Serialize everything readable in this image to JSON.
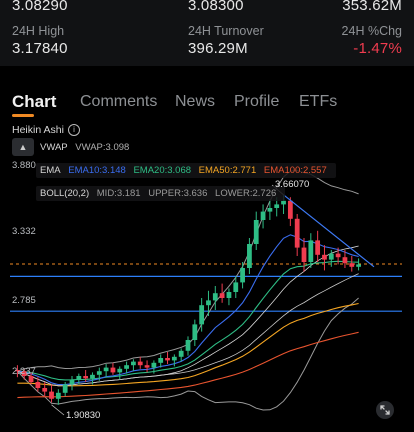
{
  "stats": {
    "row1": {
      "v1": "3.08290",
      "v2": "3.08300",
      "v3": "353.62M"
    },
    "labels": {
      "high": "24H High",
      "turnover": "24H Turnover",
      "chg": "24H %Chg"
    },
    "row2": {
      "high": "3.17840",
      "turnover": "396.29M",
      "chg": "-1.47%"
    }
  },
  "tabs": [
    "Chart",
    "Comments",
    "News",
    "Profile",
    "ETFs"
  ],
  "chart_header": {
    "type_label": "Heikin Ashi",
    "collapse": "▲"
  },
  "indicators": {
    "vwap": {
      "name": "VWAP",
      "text": "VWAP:3.098"
    },
    "ema": {
      "name": "EMA",
      "ema10": "EMA10:3.148",
      "ema20": "EMA20:3.068",
      "ema50": "EMA50:2.771",
      "ema100": "EMA100:2.557"
    },
    "boll": {
      "name": "BOLL(20,2)",
      "mid": "MID:3.181",
      "upper": "UPPER:3.636",
      "lower": "LOWER:2.726"
    }
  },
  "y_axis": [
    "3.880",
    "3.332",
    "2.785",
    "2.237"
  ],
  "price_labels": {
    "high": "3.66070",
    "low": "1.90830"
  },
  "colors": {
    "up": "#2ebd85",
    "down": "#f03c4f",
    "ema10": "#3a6df0",
    "ema20": "#2ebd85",
    "ema50": "#f5a623",
    "ema100": "#e8542f",
    "vwap": "#c9c9c9",
    "boll_upper": "#9a9a9a",
    "boll_lower": "#9a9a9a",
    "boll_mid": "#d8d8d8",
    "hline": "#2d7ff9",
    "trend": "#3d7af5",
    "last_price": "#f08a24"
  },
  "chart_data": {
    "type": "candlestick",
    "ylim": [
      1.85,
      3.95
    ],
    "candles": [
      [
        2.2,
        2.24,
        2.14,
        2.19
      ],
      [
        2.19,
        2.21,
        2.12,
        2.15
      ],
      [
        2.15,
        2.18,
        2.08,
        2.1
      ],
      [
        2.1,
        2.14,
        2.02,
        2.05
      ],
      [
        2.05,
        2.1,
        1.98,
        2.02
      ],
      [
        2.02,
        2.08,
        1.93,
        1.96
      ],
      [
        1.96,
        2.04,
        1.91,
        2.01
      ],
      [
        2.01,
        2.1,
        1.98,
        2.08
      ],
      [
        2.08,
        2.15,
        2.03,
        2.12
      ],
      [
        2.12,
        2.17,
        2.08,
        2.15
      ],
      [
        2.15,
        2.2,
        2.1,
        2.13
      ],
      [
        2.13,
        2.18,
        2.08,
        2.16
      ],
      [
        2.16,
        2.22,
        2.11,
        2.19
      ],
      [
        2.19,
        2.25,
        2.14,
        2.22
      ],
      [
        2.22,
        2.26,
        2.16,
        2.18
      ],
      [
        2.18,
        2.23,
        2.12,
        2.21
      ],
      [
        2.21,
        2.27,
        2.17,
        2.24
      ],
      [
        2.24,
        2.29,
        2.19,
        2.27
      ],
      [
        2.27,
        2.31,
        2.21,
        2.24
      ],
      [
        2.24,
        2.28,
        2.18,
        2.22
      ],
      [
        2.22,
        2.28,
        2.17,
        2.26
      ],
      [
        2.26,
        2.33,
        2.22,
        2.3
      ],
      [
        2.3,
        2.35,
        2.25,
        2.28
      ],
      [
        2.28,
        2.33,
        2.23,
        2.31
      ],
      [
        2.31,
        2.38,
        2.27,
        2.36
      ],
      [
        2.36,
        2.48,
        2.32,
        2.45
      ],
      [
        2.45,
        2.62,
        2.4,
        2.58
      ],
      [
        2.58,
        2.8,
        2.52,
        2.74
      ],
      [
        2.74,
        2.86,
        2.65,
        2.78
      ],
      [
        2.78,
        2.9,
        2.7,
        2.84
      ],
      [
        2.84,
        2.92,
        2.76,
        2.8
      ],
      [
        2.8,
        2.88,
        2.74,
        2.85
      ],
      [
        2.85,
        2.98,
        2.8,
        2.93
      ],
      [
        2.93,
        3.1,
        2.88,
        3.05
      ],
      [
        3.05,
        3.3,
        3.0,
        3.25
      ],
      [
        3.25,
        3.52,
        3.2,
        3.45
      ],
      [
        3.45,
        3.58,
        3.38,
        3.52
      ],
      [
        3.52,
        3.62,
        3.45,
        3.55
      ],
      [
        3.55,
        3.64,
        3.48,
        3.58
      ],
      [
        3.58,
        3.66,
        3.5,
        3.61
      ],
      [
        3.61,
        3.64,
        3.4,
        3.46
      ],
      [
        3.46,
        3.5,
        3.15,
        3.22
      ],
      [
        3.22,
        3.3,
        3.02,
        3.1
      ],
      [
        3.1,
        3.34,
        3.05,
        3.28
      ],
      [
        3.28,
        3.36,
        3.1,
        3.16
      ],
      [
        3.16,
        3.24,
        3.03,
        3.12
      ],
      [
        3.12,
        3.2,
        3.06,
        3.17
      ],
      [
        3.17,
        3.22,
        3.08,
        3.14
      ],
      [
        3.14,
        3.2,
        3.05,
        3.09
      ],
      [
        3.09,
        3.15,
        3.02,
        3.06
      ],
      [
        3.06,
        3.13,
        3.03,
        3.08
      ]
    ],
    "hlines": [
      2.98,
      2.69
    ],
    "last_price": 3.083
  }
}
